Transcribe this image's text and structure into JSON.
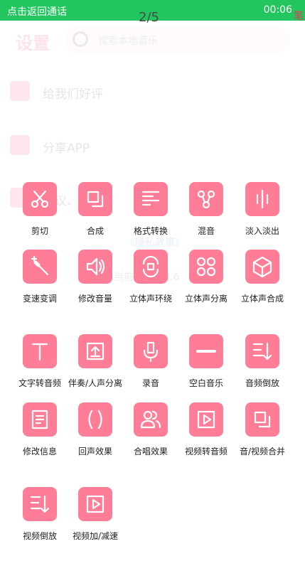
{
  "status_bar": {
    "call_text": "点击返回通话",
    "page_indicator": "2/5",
    "time": "00:06",
    "corner_mark": "笔"
  },
  "background": {
    "title": "设置",
    "search_placeholder": "搜索本地音乐",
    "rows": [
      "给我们好评",
      "分享APP",
      "协议、"
    ],
    "privacy": "《隐私政策》",
    "version": "当前版本：8.6"
  },
  "tools": [
    {
      "label": "剪切",
      "icon": "scissors-icon"
    },
    {
      "label": "合成",
      "icon": "merge-icon"
    },
    {
      "label": "格式转换",
      "icon": "format-icon"
    },
    {
      "label": "混音",
      "icon": "mix-icon"
    },
    {
      "label": "淡入淡出",
      "icon": "fade-icon"
    },
    {
      "label": "变速变调",
      "icon": "magic-wand-icon"
    },
    {
      "label": "修改音量",
      "icon": "volume-icon"
    },
    {
      "label": "立体声环绕",
      "icon": "surround-icon"
    },
    {
      "label": "立体声分离",
      "icon": "split-icon"
    },
    {
      "label": "立体声合成",
      "icon": "cube-icon"
    },
    {
      "label": "文字转音频",
      "icon": "text-icon"
    },
    {
      "label": "伴奏/人声分离",
      "icon": "upload-icon"
    },
    {
      "label": "录音",
      "icon": "microphone-icon"
    },
    {
      "label": "空白音乐",
      "icon": "minus-icon"
    },
    {
      "label": "音频倒放",
      "icon": "reverse-list-icon"
    },
    {
      "label": "修改信息",
      "icon": "info-doc-icon"
    },
    {
      "label": "回声效果",
      "icon": "echo-icon"
    },
    {
      "label": "合唱效果",
      "icon": "users-icon"
    },
    {
      "label": "视频转音频",
      "icon": "play-icon"
    },
    {
      "label": "音/视频合并",
      "icon": "merge-icon"
    },
    {
      "label": "视频倒放",
      "icon": "reverse-list-icon"
    },
    {
      "label": "视频加/减速",
      "icon": "play-icon"
    }
  ]
}
